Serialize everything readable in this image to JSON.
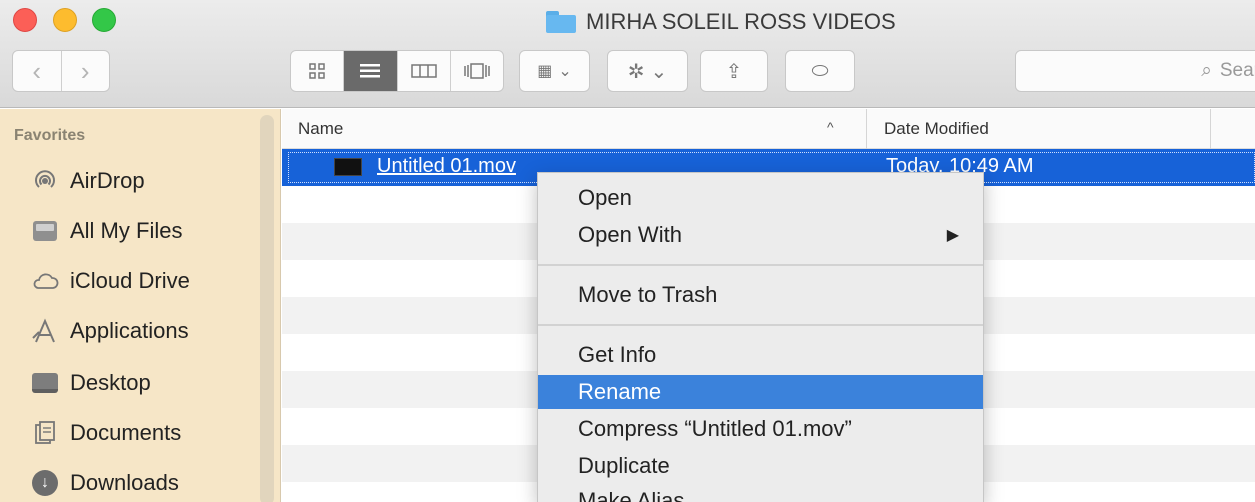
{
  "window": {
    "title": "MIRHA SOLEIL ROSS VIDEOS"
  },
  "toolbar": {
    "back_glyph": "‹",
    "forward_glyph": "›",
    "view_icons": [
      "icon-view-icon",
      "list-view-icon",
      "column-view-icon",
      "coverflow-view-icon"
    ],
    "arrange_glyph": "▦",
    "arrange_chevron": "⌄",
    "action_glyph": "✲",
    "action_chevron": "⌄",
    "share_glyph": "⇪",
    "tags_glyph": "⬭",
    "search_glyph": "⌕",
    "search_placeholder": "Sear"
  },
  "sidebar": {
    "section_title": "Favorites",
    "items": [
      {
        "label": "AirDrop",
        "icon": "airdrop-icon"
      },
      {
        "label": "All My Files",
        "icon": "all-files-icon"
      },
      {
        "label": "iCloud Drive",
        "icon": "cloud-icon"
      },
      {
        "label": "Applications",
        "icon": "applications-icon"
      },
      {
        "label": "Desktop",
        "icon": "desktop-icon"
      },
      {
        "label": "Documents",
        "icon": "documents-icon"
      },
      {
        "label": "Downloads",
        "icon": "downloads-icon"
      }
    ]
  },
  "list": {
    "columns": {
      "name": "Name",
      "sort_indicator": "^",
      "date_modified": "Date Modified"
    },
    "selected_file": {
      "name": "Untitled 01.mov",
      "date_modified": "Today, 10:49 AM"
    }
  },
  "context_menu": {
    "items": [
      "Open",
      "Open With",
      "Move to Trash",
      "Get Info",
      "Rename",
      "Compress “Untitled 01.mov”",
      "Duplicate",
      "Make Alias"
    ],
    "submenu_arrow": "▶",
    "highlighted": "Rename"
  },
  "colors": {
    "selection": "#1762d8",
    "menu_highlight": "#3b82db",
    "sidebar_bg": "#f6e6c7"
  }
}
